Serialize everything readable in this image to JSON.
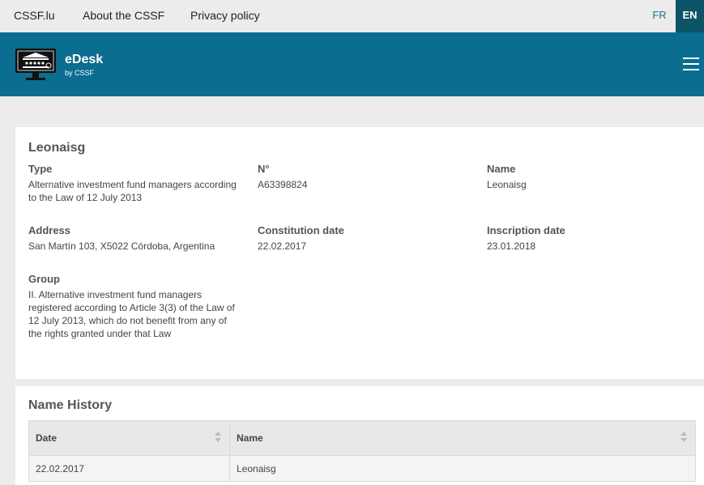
{
  "topbar": {
    "links": [
      "CSSF.lu",
      "About the CSSF",
      "Privacy policy"
    ],
    "lang_fr": "FR",
    "lang_en": "EN"
  },
  "header": {
    "title": "eDesk",
    "subtitle": "by CSSF"
  },
  "entity": {
    "title": "Leonaisg",
    "type_label": "Type",
    "type_value": "Alternative investment fund managers according to the Law of 12 July 2013",
    "number_label": "N°",
    "number_value": "A63398824",
    "name_label": "Name",
    "name_value": "Leonaisg",
    "address_label": "Address",
    "address_value": "San Martín 103, X5022 Córdoba, Argentina",
    "constitution_label": "Constitution date",
    "constitution_value": "22.02.2017",
    "inscription_label": "Inscription date",
    "inscription_value": "23.01.2018",
    "group_label": "Group",
    "group_value": "II. Alternative investment fund managers registered according to Article 3(3) of the Law of 12 July 2013, which do not benefit from any of the rights granted under that Law"
  },
  "name_history": {
    "title": "Name History",
    "columns": [
      "Date",
      "Name"
    ],
    "rows": [
      [
        "22.02.2017",
        "Leonaisg"
      ]
    ]
  },
  "colors": {
    "header_bg": "#0b6d8f",
    "lang_active_bg": "#0d5466",
    "page_bg": "#ececec"
  },
  "icons": {
    "logo": "monitor-building-icon",
    "menu": "hamburger-menu-icon",
    "sort": "sort-arrows-icon"
  }
}
